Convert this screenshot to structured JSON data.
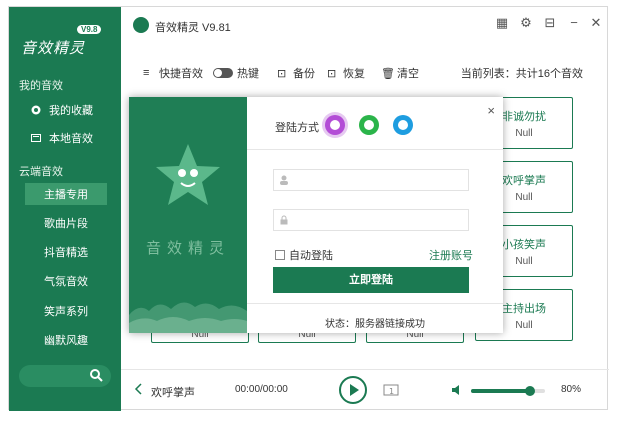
{
  "app": {
    "title": "音效精灵 V9.81",
    "logo_text": "音效精灵",
    "version_badge": "V9.8"
  },
  "sidebar": {
    "my_section": "我的音效",
    "my_items": [
      {
        "label": "我的收藏",
        "icon": "heart-icon"
      },
      {
        "label": "本地音效",
        "icon": "folder-icon"
      }
    ],
    "cloud_section": "云端音效",
    "cloud_items": [
      "主播专用",
      "歌曲片段",
      "抖音精选",
      "气氛音效",
      "笑声系列",
      "幽默风趣"
    ],
    "active_item": "主播专用",
    "search_icon": "search-icon"
  },
  "toolbar": {
    "quick_label": "快捷音效",
    "hotkey_label": "热键",
    "backup_label": "备份",
    "restore_label": "恢复",
    "clear_label": "清空",
    "list_count": "当前列表：共计16个音效"
  },
  "cards": [
    {
      "name": "非诚勿扰",
      "key": "Null"
    },
    {
      "name": "欢呼掌声",
      "key": "Null"
    },
    {
      "name": "小孩笑声",
      "key": "Null"
    },
    {
      "name": "主持出场",
      "key": "Null"
    }
  ],
  "bottom_cards": [
    "Null",
    "Null",
    "Null"
  ],
  "player": {
    "current_song": "欢呼掌声",
    "time": "00:00/00:00",
    "volume_percent": 80,
    "volume_text": "80%"
  },
  "login": {
    "method_label": "登陆方式",
    "auto_login": "自动登陆",
    "register": "注册账号",
    "login_button": "立即登陆",
    "status": "状态：服务器链接成功",
    "brand_text": "音效精灵",
    "close": "×"
  },
  "colors": {
    "brand_green": "#1b7a52",
    "sidebar_active": "#3b9a6d",
    "user_login_purple": "#b34dd6",
    "wechat_green": "#2bb44a",
    "qq_blue": "#1e9de0"
  }
}
